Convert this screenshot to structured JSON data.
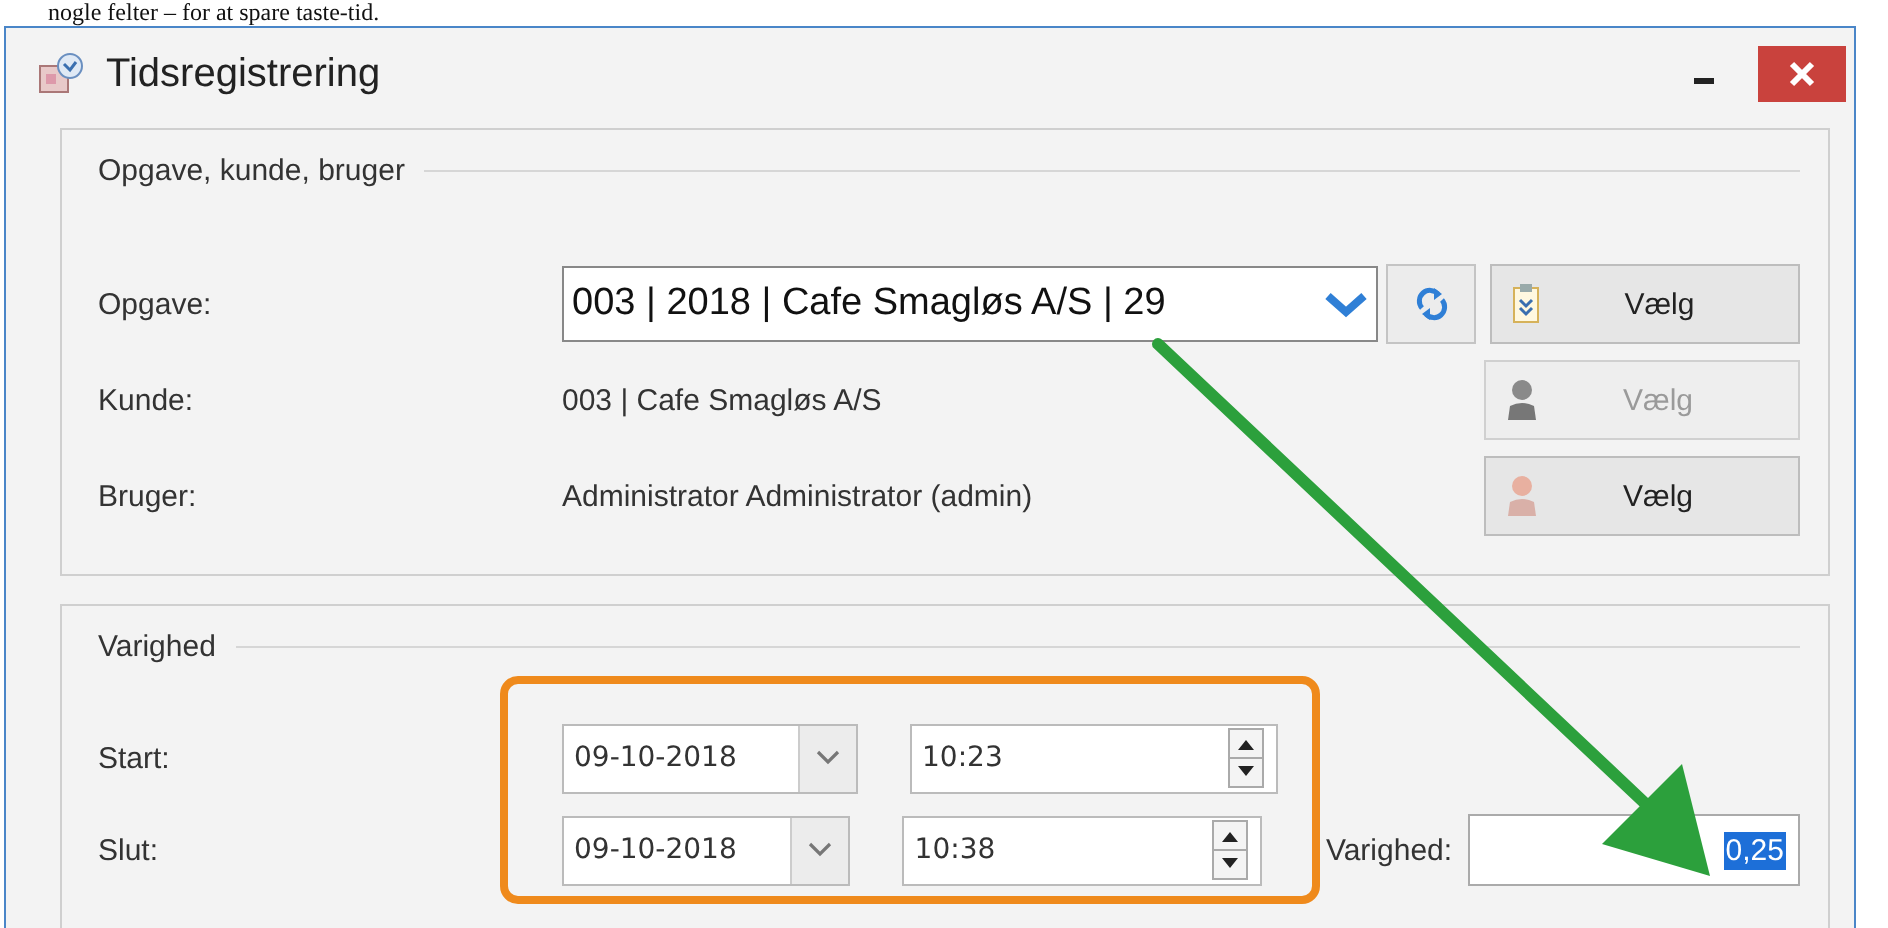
{
  "document_line": "nogle felter – for at spare taste-tid.",
  "window": {
    "title": "Tidsregistrering"
  },
  "task_group": {
    "legend": "Opgave, kunde, bruger",
    "rows": [
      {
        "kind": "combo",
        "label": "Opgave:",
        "value": "003 | 2018 | Cafe Smagløs A/S | 29",
        "button": {
          "label": "Vælg",
          "disabled": false
        }
      },
      {
        "kind": "text",
        "label": "Kunde:",
        "value": "003 | Cafe Smagløs A/S",
        "button": {
          "label": "Vælg",
          "disabled": true
        }
      },
      {
        "kind": "text",
        "label": "Bruger:",
        "value": "Administrator Administrator (admin)",
        "button": {
          "label": "Vælg",
          "disabled": false
        }
      }
    ]
  },
  "duration_group": {
    "legend": "Varighed",
    "rows": [
      {
        "label": "Start:",
        "date": "09-10-2018",
        "time": "10:23"
      },
      {
        "label": "Slut:",
        "date": "09-10-2018",
        "time": "10:38"
      }
    ],
    "duration": {
      "label": "Varighed:",
      "value": "0,25",
      "selected": true
    }
  }
}
